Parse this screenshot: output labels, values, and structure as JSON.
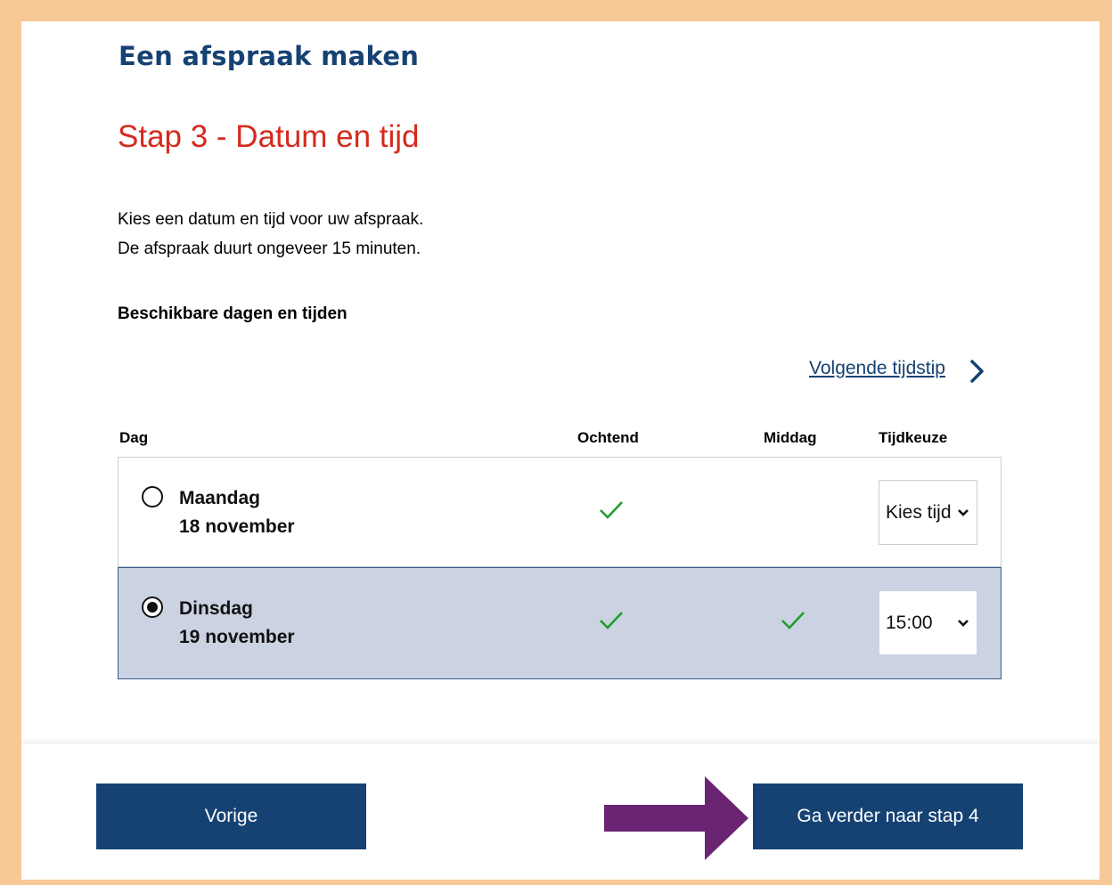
{
  "page": {
    "app_title": "Een afspraak maken",
    "step_title": "Stap 3 - Datum en tijd",
    "intro_line1": "Kies een datum en tijd voor uw afspraak.",
    "intro_line2": "De afspraak duurt ongeveer 15 minuten.",
    "section_title": "Beschikbare dagen en tijden",
    "next_time_link": "Volgende tijdstip"
  },
  "table": {
    "headers": {
      "day": "Dag",
      "morning": "Ochtend",
      "afternoon": "Middag",
      "time": "Tijdkeuze"
    },
    "rows": [
      {
        "day": "Maandag",
        "date": "18 november",
        "morning": true,
        "afternoon": false,
        "time_value": "Kies tijd",
        "selected": false
      },
      {
        "day": "Dinsdag",
        "date": "19 november",
        "morning": true,
        "afternoon": true,
        "time_value": "15:00",
        "selected": true
      }
    ]
  },
  "buttons": {
    "previous": "Vorige",
    "continue": "Ga verder naar stap 4"
  },
  "colors": {
    "brand_blue": "#154273",
    "title_red": "#d52b1e",
    "check_green": "#1f9e2e",
    "selected_row_bg": "#cbd2e2",
    "frame_border": "#f7c996",
    "annotation_arrow": "#6b2472"
  },
  "icons": {
    "next_link": "chevron-right-icon",
    "check": "checkmark-icon",
    "select": "chevron-down-icon",
    "annotation": "arrow-right-icon"
  }
}
